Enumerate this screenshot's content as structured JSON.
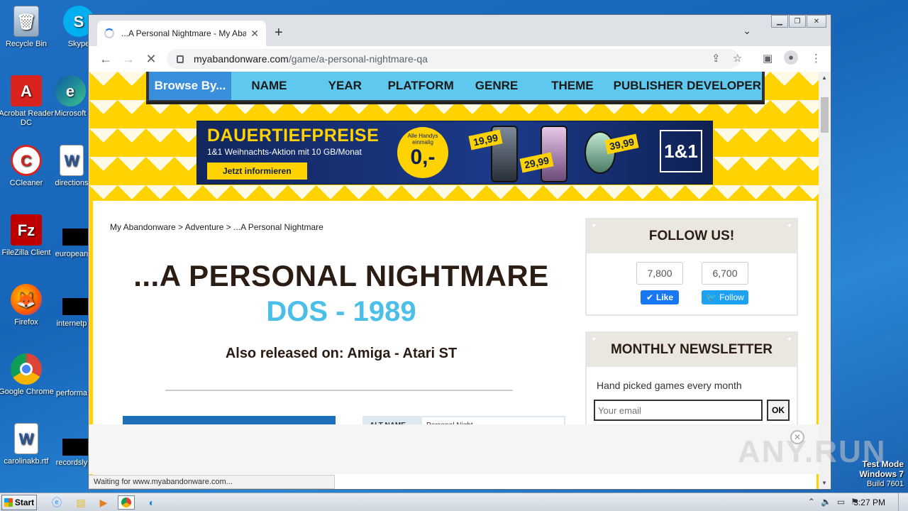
{
  "desktop": {
    "icons": [
      {
        "label": "Recycle Bin",
        "icon": "recycle-bin-icon"
      },
      {
        "label": "Skype",
        "icon": "skype-icon"
      },
      {
        "label": "Acrobat Reader DC",
        "icon": "acrobat-icon"
      },
      {
        "label": "Microsoft",
        "icon": "edge-icon"
      },
      {
        "label": "CCleaner",
        "icon": "ccleaner-icon"
      },
      {
        "label": "directions",
        "icon": "word-doc-icon"
      },
      {
        "label": "FileZilla Client",
        "icon": "filezilla-icon"
      },
      {
        "label": "european",
        "icon": "file-icon"
      },
      {
        "label": "Firefox",
        "icon": "firefox-icon"
      },
      {
        "label": "internetp",
        "icon": "file-icon"
      },
      {
        "label": "Google Chrome",
        "icon": "chrome-icon"
      },
      {
        "label": "performa",
        "icon": "file-icon"
      },
      {
        "label": "carolinakb.rtf",
        "icon": "word-doc-icon"
      },
      {
        "label": "recordsly",
        "icon": "file-icon"
      }
    ]
  },
  "browser": {
    "tab_title": "...A Personal Nightmare - My Aband",
    "url_host": "myabandonware.com",
    "url_path": "/game/a-personal-nightmare-qa",
    "status_text": "Waiting for www.myabandonware.com..."
  },
  "site": {
    "browse_by": "Browse By...",
    "nav": [
      "NAME",
      "YEAR",
      "PLATFORM",
      "GENRE",
      "THEME",
      "PUBLISHER",
      "DEVELOPER"
    ],
    "ad": {
      "headline": "DAUERTIEFPREISE",
      "sub": "1&1 Weihnachts-Aktion mit 10 GB/Monat",
      "cta": "Jetzt informieren",
      "circle_small": "Alle Handys einmalig",
      "circle_price": "0,-",
      "prices": [
        "19,99",
        "29,99",
        "39,99"
      ],
      "brand": "1&1"
    },
    "breadcrumb": "My Abandonware > Adventure > ...A Personal Nightmare",
    "game_title": "...A PERSONAL NIGHTMARE",
    "game_subtitle": "DOS - 1989",
    "also_released": "Also released on: Amiga - Atari ST",
    "info_key": "ALT NAME",
    "info_value": "Personal Night...",
    "follow": {
      "title": "FOLLOW US!",
      "fb_count": "7,800",
      "fb_label": "Like",
      "tw_count": "6,700",
      "tw_label": "Follow"
    },
    "newsletter": {
      "title": "MONTHLY NEWSLETTER",
      "text": "Hand picked games every month",
      "placeholder": "Your email",
      "button": "OK"
    }
  },
  "watermark": "ANY.RUN",
  "os": {
    "test_mode": "Test Mode",
    "edition": "Windows 7",
    "build": "Build 7601",
    "start": "Start",
    "clock": "3:27 PM"
  },
  "colors": {
    "site_yellow": "#ffd200",
    "nav_blue": "#5fc8ef",
    "browse_blue": "#3a8fdc",
    "subtitle_blue": "#4cbfe8",
    "fb_blue": "#1877f2",
    "tw_blue": "#1da1f2"
  }
}
